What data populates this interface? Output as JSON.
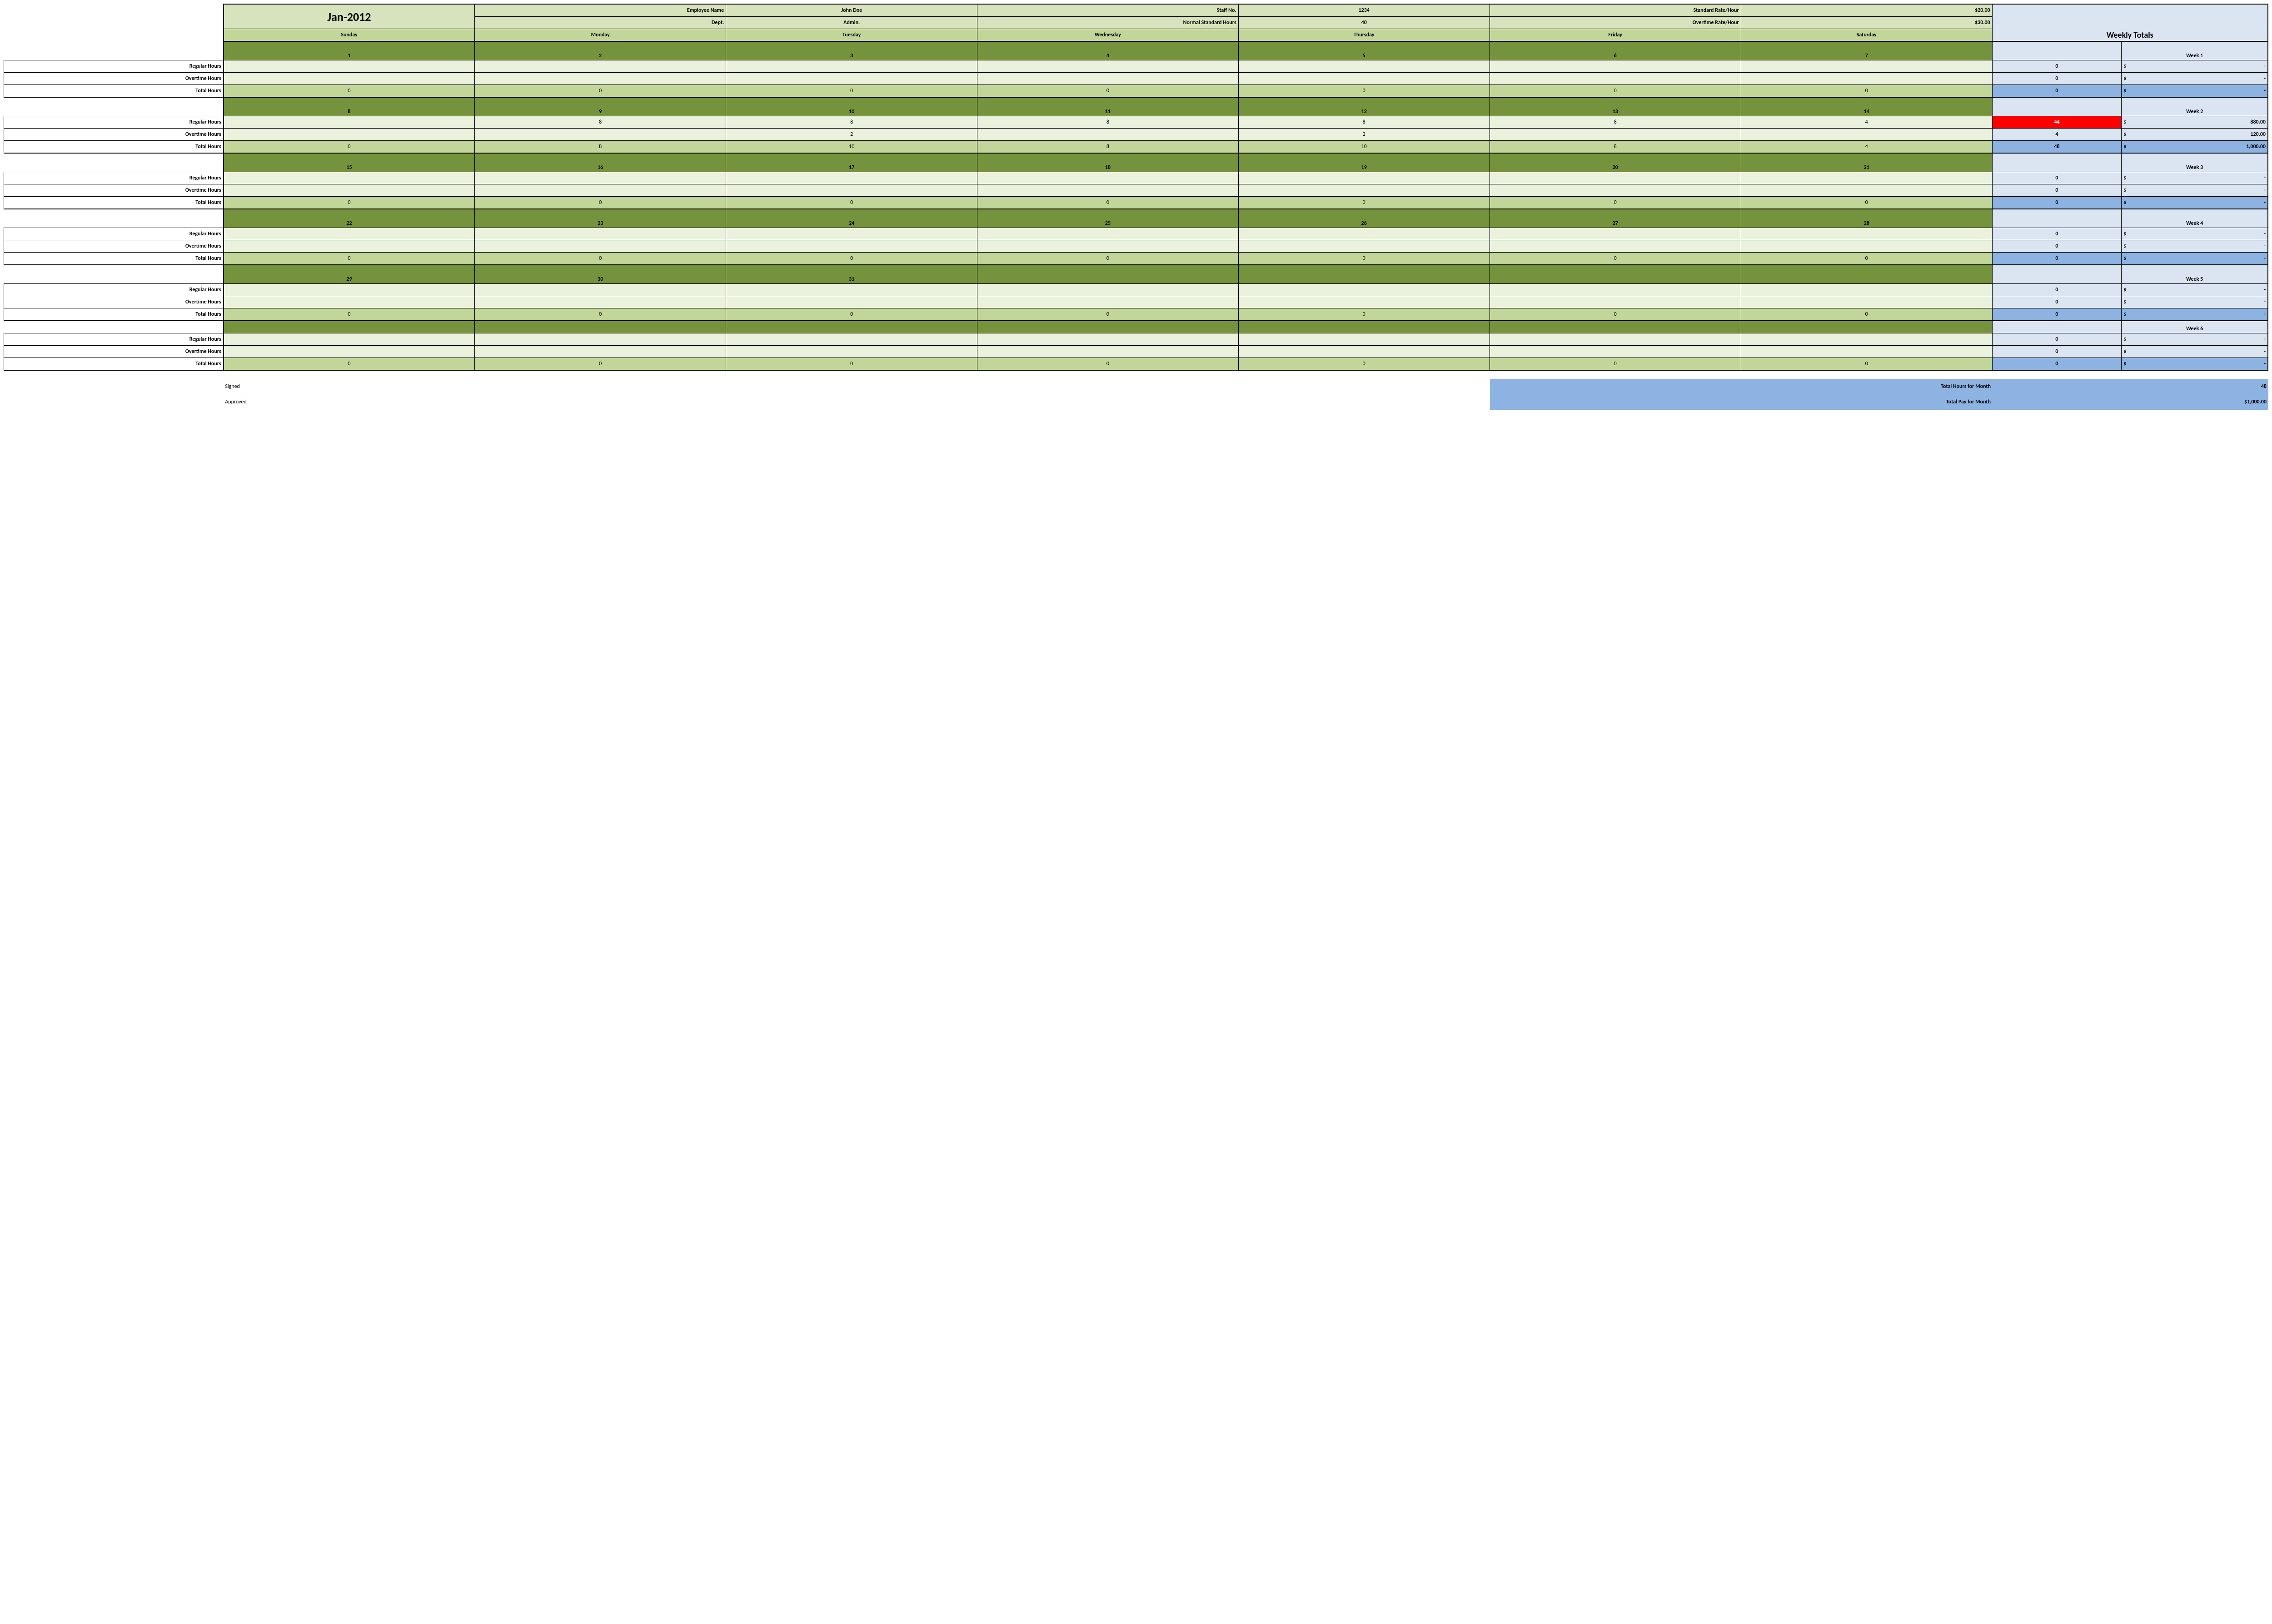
{
  "month": "Jan-2012",
  "info": {
    "empname_lbl": "Employee Name",
    "empname": "John Doe",
    "staffno_lbl": "Staff No.",
    "staffno": "1234",
    "stdrate_lbl": "Standard Rate/Hour",
    "stdrate": "$20.00",
    "dept_lbl": "Dept.",
    "dept": "Admin.",
    "normhrs_lbl": "Normal Standard Hours",
    "normhrs": "40",
    "otrate_lbl": "Overtime Rate/Hour",
    "otrate": "$30.00"
  },
  "days": [
    "Sunday",
    "Monday",
    "Tuesday",
    "Wednesday",
    "Thursday",
    "Friday",
    "Saturday"
  ],
  "totals_header": "Weekly Totals",
  "labels": {
    "reg": "Regular Hours",
    "ot": "Overtime Hours",
    "tot": "Total Hours"
  },
  "weeks": [
    {
      "title": "Week 1",
      "dates": [
        "1",
        "2",
        "3",
        "4",
        "5",
        "6",
        "7"
      ],
      "reg": [
        "",
        "",
        "",
        "",
        "",
        "",
        ""
      ],
      "ot": [
        "",
        "",
        "",
        "",
        "",
        "",
        ""
      ],
      "tot": [
        "0",
        "0",
        "0",
        "0",
        "0",
        "0",
        "0"
      ],
      "wreg_n": "0",
      "wreg_a": "-",
      "wot_n": "0",
      "wot_a": "-",
      "wtot_n": "0",
      "wtot_a": "-"
    },
    {
      "title": "Week 2",
      "dates": [
        "8",
        "9",
        "10",
        "11",
        "12",
        "13",
        "14"
      ],
      "reg": [
        "",
        "8",
        "8",
        "8",
        "8",
        "8",
        "4"
      ],
      "ot": [
        "",
        "",
        "2",
        "",
        "2",
        "",
        ""
      ],
      "tot": [
        "0",
        "8",
        "10",
        "8",
        "10",
        "8",
        "4"
      ],
      "wreg_n": "44",
      "wreg_a": "880.00",
      "wreg_red": true,
      "wot_n": "4",
      "wot_a": "120.00",
      "wtot_n": "48",
      "wtot_a": "1,000.00"
    },
    {
      "title": "Week 3",
      "dates": [
        "15",
        "16",
        "17",
        "18",
        "19",
        "20",
        "21"
      ],
      "reg": [
        "",
        "",
        "",
        "",
        "",
        "",
        ""
      ],
      "ot": [
        "",
        "",
        "",
        "",
        "",
        "",
        ""
      ],
      "tot": [
        "0",
        "0",
        "0",
        "0",
        "0",
        "0",
        "0"
      ],
      "wreg_n": "0",
      "wreg_a": "-",
      "wot_n": "0",
      "wot_a": "-",
      "wtot_n": "0",
      "wtot_a": "-"
    },
    {
      "title": "Week 4",
      "dates": [
        "22",
        "23",
        "24",
        "25",
        "26",
        "27",
        "28"
      ],
      "reg": [
        "",
        "",
        "",
        "",
        "",
        "",
        ""
      ],
      "ot": [
        "",
        "",
        "",
        "",
        "",
        "",
        ""
      ],
      "tot": [
        "0",
        "0",
        "0",
        "0",
        "0",
        "0",
        "0"
      ],
      "wreg_n": "0",
      "wreg_a": "-",
      "wot_n": "0",
      "wot_a": "-",
      "wtot_n": "0",
      "wtot_a": "-"
    },
    {
      "title": "Week 5",
      "dates": [
        "29",
        "30",
        "31",
        "",
        "",
        "",
        ""
      ],
      "reg": [
        "",
        "",
        "",
        "",
        "",
        "",
        ""
      ],
      "ot": [
        "",
        "",
        "",
        "",
        "",
        "",
        ""
      ],
      "tot": [
        "0",
        "0",
        "0",
        "0",
        "0",
        "0",
        "0"
      ],
      "wreg_n": "0",
      "wreg_a": "-",
      "wot_n": "0",
      "wot_a": "-",
      "wtot_n": "0",
      "wtot_a": "-"
    },
    {
      "title": "Week 6",
      "dates": [
        "",
        "",
        "",
        "",
        "",
        "",
        ""
      ],
      "reg": [
        "",
        "",
        "",
        "",
        "",
        "",
        ""
      ],
      "ot": [
        "",
        "",
        "",
        "",
        "",
        "",
        ""
      ],
      "tot": [
        "0",
        "0",
        "0",
        "0",
        "0",
        "0",
        "0"
      ],
      "wreg_n": "0",
      "wreg_a": "-",
      "wot_n": "0",
      "wot_a": "-",
      "wtot_n": "0",
      "wtot_a": "-"
    }
  ],
  "footer": {
    "signed": "Signed",
    "approved": "Approved",
    "tothrs_lbl": "Total Hours for Month",
    "tothrs": "48",
    "totpay_lbl": "Total Pay for Month",
    "totpay": "$1,000.00"
  }
}
